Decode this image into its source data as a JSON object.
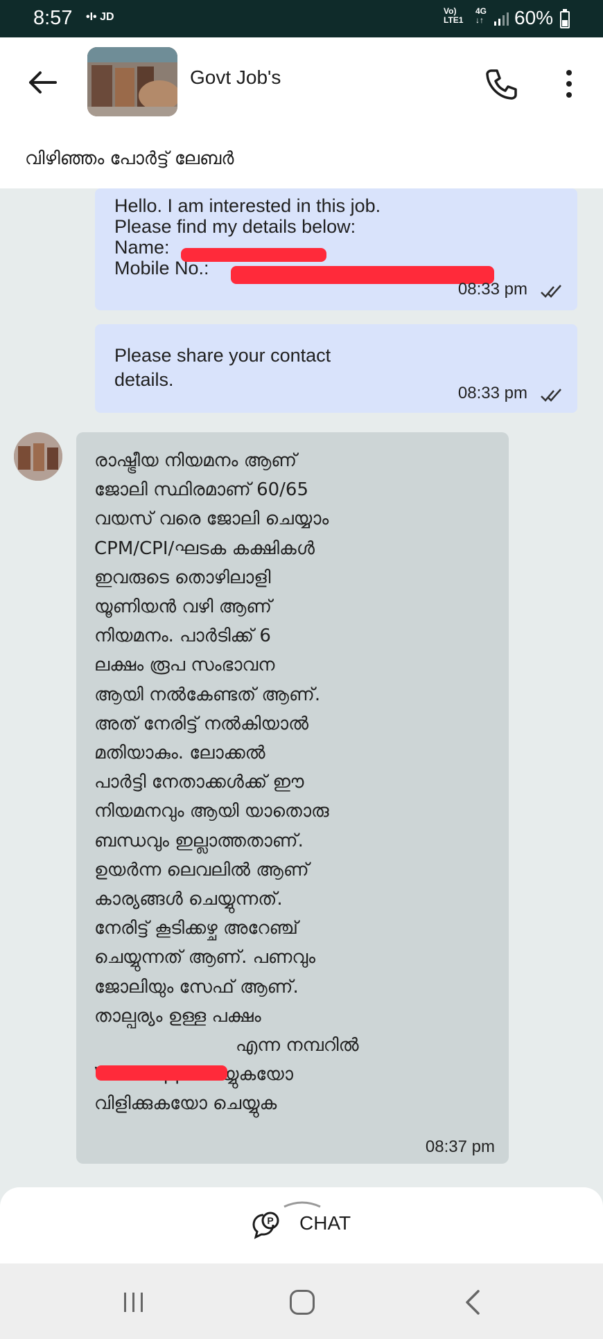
{
  "status_bar": {
    "time": "8:57",
    "notif_icons": "•I• JD",
    "network_line1": "Vo)",
    "network_line2": "LTE1",
    "network_gen1": "4G",
    "network_gen2": "↓↑",
    "battery": "60%"
  },
  "header": {
    "title": "Govt Job's",
    "subtitle": "വിഴിഞ്ഞം പോർട്ട് ലേബർ"
  },
  "messages": {
    "m1": {
      "lines": "Hello. I am interested in this job.\nPlease find my details below:\nName: \nMobile No.: ",
      "time": "08:33 pm"
    },
    "m2": {
      "lines": "Please share your contact\ndetails.",
      "time": "08:33 pm"
    },
    "m3": {
      "lines": [
        "രാഷ്ട്രീയ നിയമനം ആണ്",
        "ജോലി സ്ഥിരമാണ് 60/65",
        "വയസ് വരെ ജോലി ചെയ്യാം",
        "CPM/CPI/ഘടക കക്ഷികൾ",
        "ഇവരുടെ തൊഴിലാളി",
        "യൂണിയൻ വഴി ആണ്",
        "നിയമനം. പാർടിക്ക് 6",
        "ലക്ഷം രൂപ സംഭാവന",
        "ആയി നൽകേണ്ടത് ആണ്.",
        "അത് നേരിട്ട് നൽകിയാൽ",
        "മതിയാകും. ലോക്കൽ",
        "പാർട്ടി നേതാക്കൾക്ക് ഈ",
        "നിയമനവും ആയി യാതൊരു",
        "ബന്ധവും ഇല്ലാത്തതാണ്.",
        "ഉയർന്ന ലെവലിൽ ആണ്",
        "കാര്യങ്ങൾ ചെയ്യുന്നത്.",
        "നേരിട്ട് കൂടിക്കഴ്ച അറേഞ്ച്",
        "ചെയ്യുന്നത് ആണ്. പണവും",
        "ജോലിയും സേഫ് ആണ്.",
        "താല്പര്യം ഉള്ള പക്ഷം",
        "എന്ന നമ്പറിൽ",
        "WhatsApp ചെയ്യുകയോ",
        "വിളിക്കുകയോ ചെയ്യുക"
      ],
      "time": "08:37 pm"
    }
  },
  "bottom": {
    "chat_label": "CHAT"
  },
  "colors": {
    "status_bar": "#0f2b2a",
    "outgoing_bubble": "#d9e3fb",
    "incoming_bubble": "#cdd5d6",
    "redaction": "#ff2a3a"
  },
  "icons": [
    "back-arrow-icon",
    "phone-icon",
    "more-vert-icon",
    "double-check-icon",
    "chat-bubble-icon",
    "recents-icon",
    "home-icon",
    "nav-back-icon"
  ]
}
